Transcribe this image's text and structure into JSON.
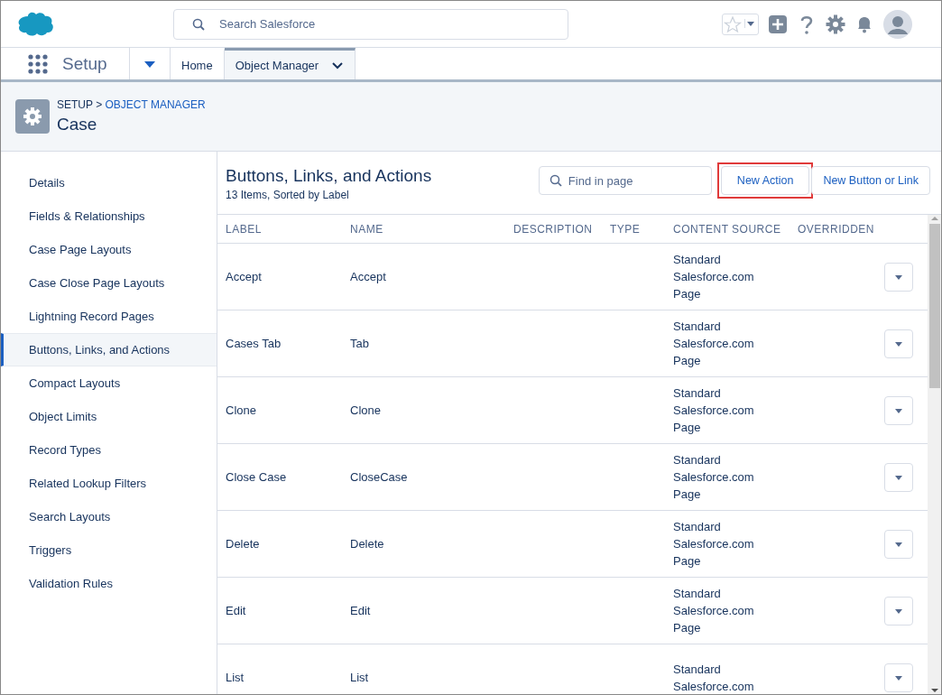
{
  "header": {
    "search": {
      "placeholder": "Search Salesforce"
    }
  },
  "nav": {
    "app_name": "Setup",
    "tabs": [
      {
        "label": "Home",
        "selected": false
      },
      {
        "label": "Object Manager",
        "selected": true
      }
    ]
  },
  "page_header": {
    "breadcrumb": {
      "root": "SETUP",
      "separator": ">",
      "link": "OBJECT MANAGER"
    },
    "title": "Case"
  },
  "sidebar": {
    "items": [
      {
        "label": "Details",
        "selected": false
      },
      {
        "label": "Fields & Relationships",
        "selected": false
      },
      {
        "label": "Case Page Layouts",
        "selected": false
      },
      {
        "label": "Case Close Page Layouts",
        "selected": false
      },
      {
        "label": "Lightning Record Pages",
        "selected": false
      },
      {
        "label": "Buttons, Links, and Actions",
        "selected": true
      },
      {
        "label": "Compact Layouts",
        "selected": false
      },
      {
        "label": "Object Limits",
        "selected": false
      },
      {
        "label": "Record Types",
        "selected": false
      },
      {
        "label": "Related Lookup Filters",
        "selected": false
      },
      {
        "label": "Search Layouts",
        "selected": false
      },
      {
        "label": "Triggers",
        "selected": false
      },
      {
        "label": "Validation Rules",
        "selected": false
      }
    ]
  },
  "main": {
    "title": "Buttons, Links, and Actions",
    "subtitle": "13 Items, Sorted by Label",
    "search": {
      "placeholder": "Find in page"
    },
    "buttons": [
      {
        "label": "New Action",
        "highlighted": true
      },
      {
        "label": "New Button or Link",
        "highlighted": false
      }
    ],
    "table": {
      "columns": [
        "LABEL",
        "NAME",
        "DESCRIPTION",
        "TYPE",
        "CONTENT SOURCE",
        "OVERRIDDEN"
      ],
      "rows": [
        {
          "label": "Accept",
          "name": "Accept",
          "content_source": [
            "Standard",
            "Salesforce.com",
            "Page"
          ]
        },
        {
          "label": "Cases Tab",
          "name": "Tab",
          "content_source": [
            "Standard",
            "Salesforce.com",
            "Page"
          ]
        },
        {
          "label": "Clone",
          "name": "Clone",
          "content_source": [
            "Standard",
            "Salesforce.com",
            "Page"
          ]
        },
        {
          "label": "Close Case",
          "name": "CloseCase",
          "content_source": [
            "Standard",
            "Salesforce.com",
            "Page"
          ]
        },
        {
          "label": "Delete",
          "name": "Delete",
          "content_source": [
            "Standard",
            "Salesforce.com",
            "Page"
          ]
        },
        {
          "label": "Edit",
          "name": "Edit",
          "content_source": [
            "Standard",
            "Salesforce.com",
            "Page"
          ]
        },
        {
          "label": "List",
          "name": "List",
          "content_source": [
            "Standard",
            "Salesforce.com"
          ]
        }
      ]
    }
  }
}
